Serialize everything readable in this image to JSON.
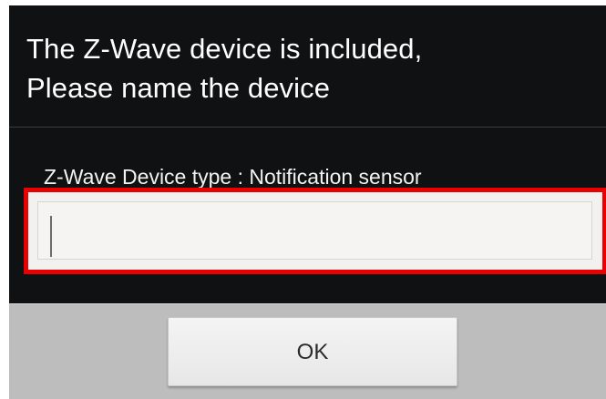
{
  "dialog": {
    "title_line_1": "The Z-Wave device is included,",
    "title_line_2": "Please name the device",
    "device_type_label": "Z-Wave Device type : Notification sensor",
    "name_input": {
      "value": "",
      "placeholder": ""
    },
    "ok_label": "OK"
  },
  "colors": {
    "dialog_background": "#0f1112",
    "highlight_border": "#e90000",
    "input_background": "#f2f1ef",
    "button_bar": "#bdbdbd"
  }
}
